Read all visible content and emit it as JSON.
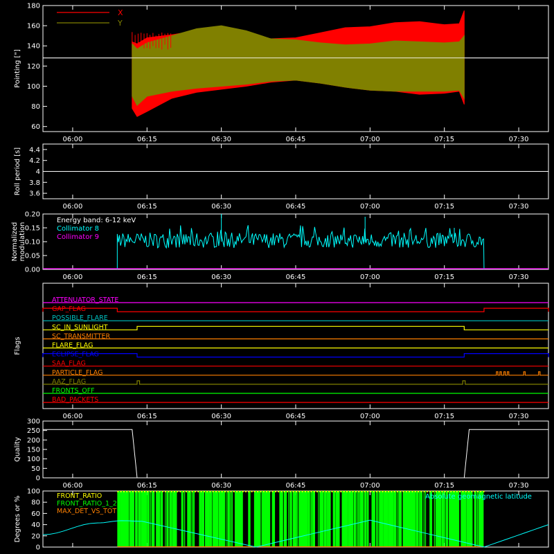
{
  "time_axis": {
    "ticks": [
      "06:00",
      "06:15",
      "06:30",
      "06:45",
      "07:00",
      "07:15",
      "07:30"
    ],
    "range": [
      "05:54",
      "07:36"
    ]
  },
  "colors": {
    "background": "#000000",
    "axes": "#ffffff",
    "x_red": "#ff0000",
    "y_olive": "#808000",
    "cyan": "#00ffff",
    "magenta": "#ff00ff",
    "green": "#00ff00",
    "yellow": "#ffff00",
    "orange": "#ff8000",
    "blue": "#0000ff",
    "teal": "#00c0c0",
    "brown": "#c06040"
  },
  "chart_data": [
    {
      "id": "pointing",
      "type": "area",
      "ylabel": "Pointing [\"]",
      "ylim": [
        55,
        180
      ],
      "yticks": [
        60,
        80,
        100,
        120,
        140,
        160,
        180
      ],
      "legend": [
        {
          "name": "X",
          "color": "#ff0000"
        },
        {
          "name": "Y",
          "color": "#808000"
        }
      ],
      "legend_placement": "top-left",
      "reference_level": 128,
      "data_start": "06:12",
      "data_end": "07:19",
      "series": [
        {
          "name": "X",
          "x": [
            "06:12",
            "06:13",
            "06:15",
            "06:20",
            "06:25",
            "06:30",
            "06:35",
            "06:40",
            "06:45",
            "06:50",
            "06:55",
            "07:00",
            "07:05",
            "07:10",
            "07:15",
            "07:18",
            "07:19"
          ],
          "upper": [
            144,
            142,
            148,
            151,
            155,
            158,
            152,
            147,
            148,
            153,
            158,
            159,
            163,
            164,
            161,
            162,
            175
          ],
          "lower": [
            78,
            70,
            75,
            88,
            94,
            97,
            100,
            104,
            106,
            103,
            99,
            96,
            95,
            92,
            93,
            95,
            82
          ]
        },
        {
          "name": "Y",
          "x": [
            "06:12",
            "06:13",
            "06:15",
            "06:20",
            "06:25",
            "06:30",
            "06:35",
            "06:40",
            "06:45",
            "06:50",
            "06:55",
            "07:00",
            "07:05",
            "07:10",
            "07:15",
            "07:18",
            "07:19"
          ],
          "upper": [
            142,
            137,
            143,
            150,
            157,
            160,
            155,
            147,
            146,
            143,
            141,
            142,
            145,
            144,
            143,
            144,
            150
          ],
          "lower": [
            90,
            81,
            90,
            95,
            98,
            100,
            102,
            105,
            106,
            103,
            99,
            96,
            95,
            95,
            95,
            96,
            88
          ]
        }
      ]
    },
    {
      "id": "roll-period",
      "type": "line",
      "ylabel": "Roll period [s]",
      "ylim": [
        3.5,
        4.5
      ],
      "yticks": [
        3.6,
        3.8,
        4.0,
        4.2,
        4.4
      ],
      "series": [
        {
          "x": [
            "05:54",
            "07:36"
          ],
          "y": [
            4.0,
            4.0
          ]
        }
      ]
    },
    {
      "id": "modulation",
      "type": "line",
      "ylabel": "Normalized modulation",
      "ylim": [
        0,
        0.2
      ],
      "yticks": [
        "0.00",
        "0.05",
        "0.10",
        "0.15",
        "0.20"
      ],
      "annotation": "Energy band: 6-12 keV",
      "legend": [
        {
          "name": "Collimator 8",
          "color": "#00ffff"
        },
        {
          "name": "Collimator 9",
          "color": "#ff00ff"
        }
      ],
      "legend_placement": "top-left",
      "series": [
        {
          "name": "Collimator 8",
          "x_start": "06:09",
          "x_end": "07:23",
          "typical": 0.105,
          "range": [
            0.08,
            0.135
          ],
          "spikes": [
            {
              "x": "06:30",
              "y": 0.2
            },
            {
              "x": "06:59",
              "y": 0.19
            },
            {
              "x": "07:17",
              "y": 0.15
            }
          ]
        },
        {
          "name": "Collimator 9",
          "y": 0.0
        }
      ]
    },
    {
      "id": "flags",
      "type": "line",
      "ylabel": "Flags",
      "rows": [
        {
          "name": "ATTENUATOR_STATE",
          "color": "#ff00ff",
          "high": []
        },
        {
          "name": "GAP_FLAG",
          "color": "#ff0000",
          "high": [
            [
              "05:54",
              "06:09"
            ],
            [
              "07:23",
              "07:36"
            ]
          ]
        },
        {
          "name": "POSSIBLE_FLARE",
          "color": "#00c0c0",
          "high": []
        },
        {
          "name": "SC_IN_SUNLIGHT",
          "color": "#ffff00",
          "high": [
            [
              "06:13",
              "07:19"
            ]
          ]
        },
        {
          "name": "SC_TRANSMITTER",
          "color": "#ff8000",
          "high": []
        },
        {
          "name": "FLARE_FLAG",
          "color": "#ffff00",
          "high": []
        },
        {
          "name": "ECLIPSE_FLAG",
          "color": "#0000ff",
          "high": [
            [
              "05:54",
              "06:13"
            ],
            [
              "07:19",
              "07:36"
            ]
          ]
        },
        {
          "name": "SAA_FLAG",
          "color": "#ff0000",
          "high": []
        },
        {
          "name": "PARTICLE_FLAG",
          "color": "#ff8000",
          "high": [
            [
              "07:25.5",
              "07:25.8"
            ],
            [
              "07:26.2",
              "07:26.5"
            ],
            [
              "07:27",
              "07:27.3"
            ],
            [
              "07:27.7",
              "07:28"
            ],
            [
              "07:31",
              "07:31.3"
            ],
            [
              "07:34",
              "07:34.3"
            ]
          ]
        },
        {
          "name": "AAZ_FLAG",
          "color": "#808000",
          "high": [
            [
              "06:13",
              "06:13.5"
            ],
            [
              "07:18.7",
              "07:19.2"
            ]
          ]
        },
        {
          "name": "FRONTS_OFF",
          "color": "#00ff00",
          "high": []
        },
        {
          "name": "BAD_PACKETS",
          "color": "#ff0000",
          "high": []
        }
      ]
    },
    {
      "id": "quality",
      "type": "line",
      "ylabel": "Quality",
      "ylim": [
        0,
        300
      ],
      "yticks": [
        0,
        50,
        100,
        150,
        200,
        250,
        300
      ],
      "series": [
        {
          "x": [
            "05:54",
            "06:12",
            "06:13",
            "07:19",
            "07:20",
            "07:36"
          ],
          "y": [
            255,
            255,
            0,
            0,
            255,
            255
          ]
        }
      ]
    },
    {
      "id": "ratios",
      "type": "line",
      "ylabel": "Degrees or %",
      "ylim": [
        0,
        100
      ],
      "yticks": [
        0,
        20,
        40,
        60,
        80,
        100
      ],
      "legend": [
        {
          "name": "FRONT_RATIO",
          "color": "#ffff00"
        },
        {
          "name": "FRONT_RATIO_1_2",
          "color": "#00ff00"
        },
        {
          "name": "MAX_DET_VS_TOT",
          "color": "#ff8000"
        }
      ],
      "legend_placement": "top-left",
      "annotation": "Absolute geomagnetic latitude",
      "series": [
        {
          "name": "FRONT_RATIO_1_2",
          "x_start": "06:09",
          "x_end": "07:23",
          "range": [
            0,
            100
          ]
        },
        {
          "name": "Absolute geomagnetic latitude",
          "x": [
            "05:54",
            "06:05",
            "06:10",
            "06:14",
            "06:37",
            "07:00",
            "07:23",
            "07:36"
          ],
          "y": [
            22,
            43,
            47,
            46,
            0,
            48,
            0,
            40
          ]
        }
      ]
    }
  ]
}
